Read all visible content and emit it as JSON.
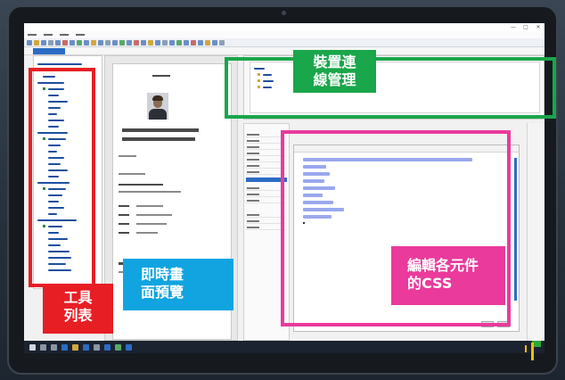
{
  "annotations": {
    "tool_list": {
      "line1": "工具",
      "line2": "列表",
      "color": "#e81e25"
    },
    "live_preview": {
      "line1": "即時畫",
      "line2": "面預覽",
      "color": "#12a4e0"
    },
    "device_connection": {
      "line1": "裝置連",
      "line2": "線管理",
      "color": "#1aa64a"
    },
    "css_editor": {
      "line1": "編輯各元件",
      "line2": "的CSS",
      "color": "#ea3a9c"
    }
  },
  "window": {
    "buttons": [
      "—",
      "□",
      "✕"
    ]
  },
  "colors": {
    "accent": "#2b6cc4",
    "code_highlight": "#9aa8ee",
    "taskbar": "#1b2230"
  },
  "icons": [
    "start-icon",
    "search-icon",
    "taskview-icon",
    "edge-icon",
    "explorer-icon",
    "store-icon",
    "mail-icon",
    "app-icon"
  ]
}
